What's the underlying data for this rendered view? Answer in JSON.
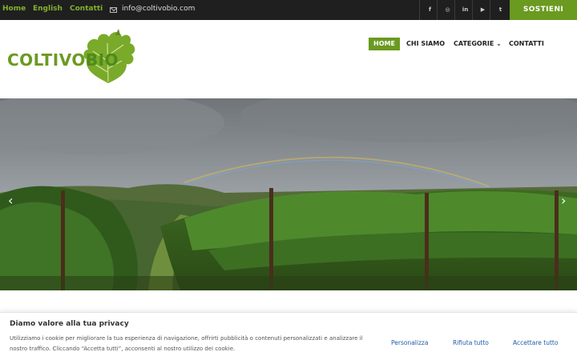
{
  "topbar": {
    "links": [
      "Home",
      "English",
      "Contatti"
    ],
    "email": "info@coltivobio.com",
    "social_icons": [
      "facebook-icon",
      "instagram-icon",
      "linkedin-icon",
      "youtube-icon",
      "tumblr-icon"
    ],
    "social_glyphs": [
      "f",
      "◎",
      "in",
      "▶",
      "t"
    ],
    "donate_label": "SOSTIENI"
  },
  "logo": {
    "part1": "COLTIVO",
    "part2": "BIO"
  },
  "nav": {
    "items": [
      "HOME",
      "CHI SIAMO",
      "CATEGORIE",
      "CONTATTI"
    ],
    "dropdown_glyph": "⌄"
  },
  "hero": {
    "prev_arrow": "‹",
    "next_arrow": "›"
  },
  "cookie": {
    "title": "Diamo valore alla tua privacy",
    "text": "Utilizziamo i cookie per migliorare la tua esperienza di navigazione, offrirti pubblicità o contenuti personalizzati e analizzare il nostro traffico. Cliccando “Accetta tutti”, acconsenti al nostro utilizzo dei cookie.",
    "customize": "Personalizza",
    "reject": "Rifiuta tutto",
    "accept": "Accettare tutto"
  },
  "colors": {
    "accent": "#6a9a1f",
    "topbar": "#1f1f1f",
    "link": "#1e5aa8"
  }
}
